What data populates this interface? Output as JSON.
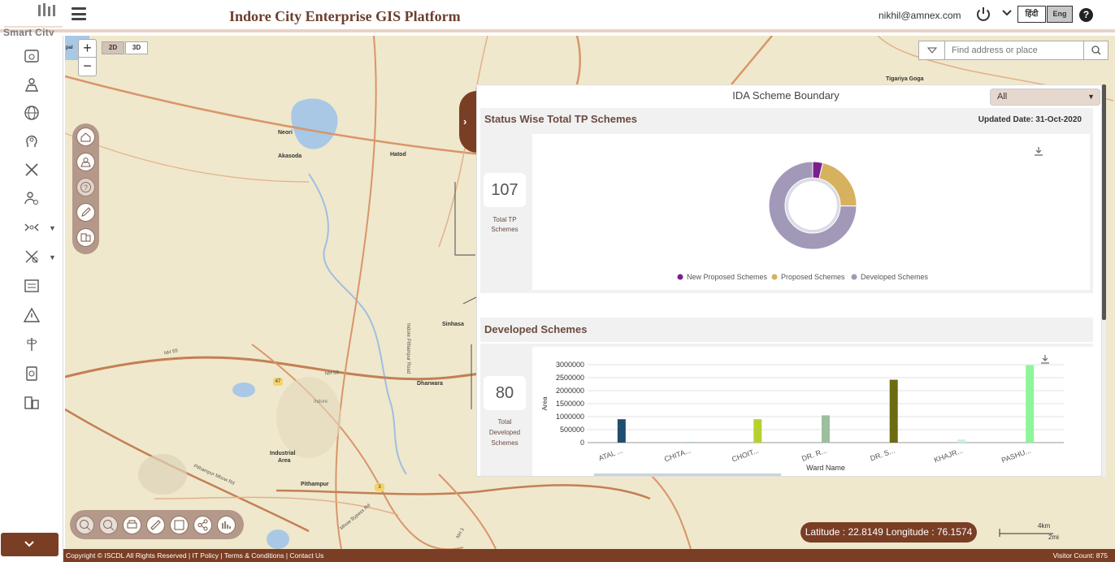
{
  "header": {
    "app_title": "Indore City Enterprise GIS Platform",
    "logo_text": "Smart City",
    "user_email": "nikhil@amnex.com",
    "lang_hi": "हिंदी",
    "lang_en": "Eng",
    "help": "?"
  },
  "sidebar": {
    "items": [
      "dashboard-icon",
      "user-location-icon",
      "globe-icon",
      "head-gear-icon",
      "tools-icon",
      "user-settings-icon",
      "network-icon",
      "settings-tools-icon",
      "list-icon",
      "warning-icon",
      "signpost-icon",
      "document-icon",
      "gallery-icon"
    ]
  },
  "map": {
    "zoom_in": "+",
    "zoom_out": "−",
    "view_2d": "2D",
    "view_3d": "3D",
    "search_placeholder": "Find address or place",
    "latlon": "Latitude : 22.8149 Longitude : 76.1574",
    "scale_km": "4km",
    "scale_mi": "2mi",
    "labels": {
      "neori": "Neori",
      "akasoda": "Akasoda",
      "hatod": "Hatod",
      "sinhasa": "Sinhasa",
      "dharwara": "Dharwara",
      "industrial": "Industrial",
      "area": "Area",
      "pithampur": "Pithampur",
      "tigariya": "Tigariya Goga",
      "indore": "Indore",
      "nh59": "NH 59",
      "nh59b": "NH 59",
      "r47": "47",
      "r3": "3",
      "pal": "pal",
      "pithampur_rd": "Pithampur Mhow Rd",
      "mhow_rd": "Mhow Bypass Rd",
      "ringroad": "Indore Pithampur Road",
      "nh3": "NH 3"
    }
  },
  "panel": {
    "title": "IDA Scheme Boundary",
    "select_value": "All",
    "status_section": {
      "title": "Status Wise Total TP Schemes",
      "updated": "Updated Date: 31-Oct-2020",
      "total_value": "107",
      "total_label_1": "Total TP",
      "total_label_2": "Schemes",
      "legend": [
        "New Proposed Schemes",
        "Proposed Schemes",
        "Developed Schemes"
      ]
    },
    "developed_section": {
      "title": "Developed Schemes",
      "total_value": "80",
      "total_label_1": "Total",
      "total_label_2": "Developed",
      "total_label_3": "Schemes"
    }
  },
  "chart_data": [
    {
      "type": "pie",
      "donut": true,
      "labels": [
        "New Proposed Schemes",
        "Proposed Schemes",
        "Developed Schemes"
      ],
      "values": [
        4,
        23,
        80
      ],
      "colors": [
        "#7b1f8f",
        "#d6b25f",
        "#a299b9"
      ]
    },
    {
      "type": "bar",
      "categories": [
        "ATAL ...",
        "CHITA...",
        "CHOIT...",
        "DR. R...",
        "DR. S...",
        "KHAJR...",
        "PASHU..."
      ],
      "values": [
        900000,
        30000,
        900000,
        1050000,
        2420000,
        120000,
        2980000
      ],
      "colors": [
        "#1f4e6e",
        "#a6c9d8",
        "#b5d12f",
        "#9bbf9f",
        "#6b6b12",
        "#c8f0ec",
        "#8ff59a"
      ],
      "xlabel": "Ward Name",
      "ylabel": "Area",
      "ylim": [
        0,
        3000000
      ],
      "yticks": [
        0,
        500000,
        1000000,
        1500000,
        2000000,
        2500000,
        3000000
      ]
    }
  ],
  "footer": {
    "left": "Copyright © ISCDL All Rights Reserved | IT Policy | Terms & Conditions | Contact Us",
    "right": "Visitor Count: 875"
  }
}
